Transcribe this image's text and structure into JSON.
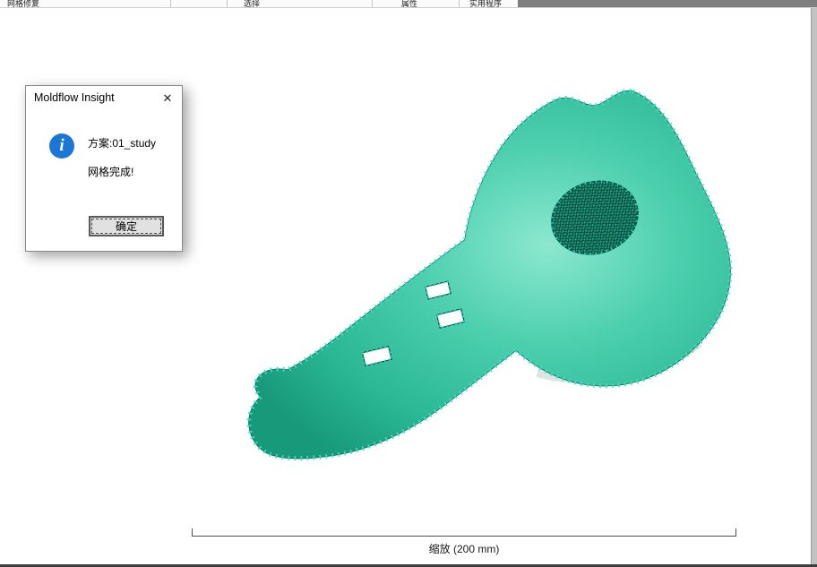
{
  "ribbon": {
    "tabs": [
      {
        "label": "网格修复"
      },
      {
        "label": "选择"
      },
      {
        "label": "属性"
      },
      {
        "label": "实用程序"
      }
    ]
  },
  "dialog": {
    "title": "Moldflow Insight",
    "close_glyph": "✕",
    "icon": "info-icon",
    "icon_glyph": "i",
    "message_line1": "方案:01_study",
    "message_line2": "网格完成!",
    "ok_label": "确定"
  },
  "canvas": {
    "scale_label": "缩放 (200 mm)"
  },
  "colors": {
    "mesh_fill": "#3cc9a7",
    "mesh_fill_light": "#8ce8cf",
    "mesh_fill_dark": "#17997a",
    "mesh_edge": "#0c5c4a",
    "boundary_node": "#35e2c8",
    "info_icon_blue": "#1b76d6",
    "ribbon_dark": "#7e7e7e"
  }
}
